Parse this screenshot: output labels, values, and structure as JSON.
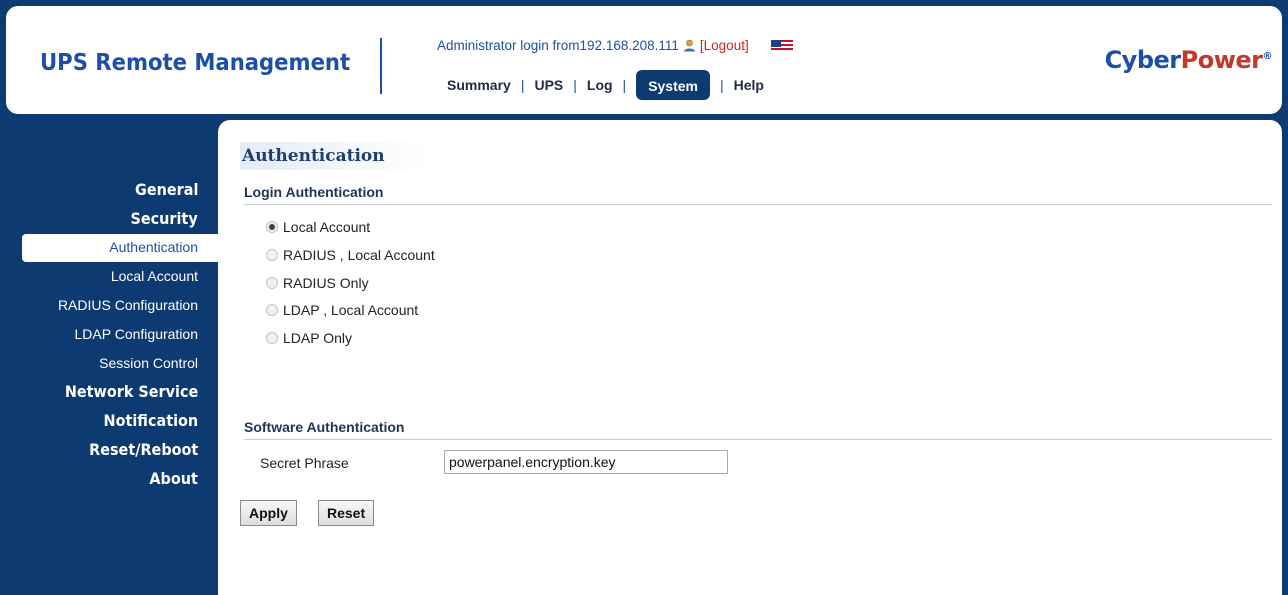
{
  "header": {
    "brand": "UPS Remote Management",
    "login_text": "Administrator login from192.168.208.111",
    "logout_label": "[Logout]",
    "vendor_logo": {
      "part1": "Cyber",
      "part2": "Power",
      "mark": "®"
    }
  },
  "nav": {
    "items": [
      "Summary",
      "UPS",
      "Log",
      "System",
      "Help"
    ],
    "active": "System"
  },
  "sidebar": {
    "items": [
      {
        "label": "General",
        "major": true
      },
      {
        "label": "Security",
        "major": true
      },
      {
        "label": "Authentication",
        "active": true
      },
      {
        "label": "Local Account"
      },
      {
        "label": "RADIUS Configuration"
      },
      {
        "label": "LDAP Configuration"
      },
      {
        "label": "Session Control"
      },
      {
        "label": "Network Service",
        "major": true
      },
      {
        "label": "Notification",
        "major": true
      },
      {
        "label": "Reset/Reboot",
        "major": true
      },
      {
        "label": "About",
        "major": true
      }
    ]
  },
  "main": {
    "page_title": "Authentication",
    "login_auth": {
      "heading": "Login Authentication",
      "options": [
        {
          "label": "Local Account",
          "checked": true
        },
        {
          "label": "RADIUS , Local Account",
          "checked": false
        },
        {
          "label": "RADIUS Only",
          "checked": false
        },
        {
          "label": "LDAP , Local Account",
          "checked": false
        },
        {
          "label": "LDAP Only",
          "checked": false
        }
      ]
    },
    "software_auth": {
      "heading": "Software Authentication",
      "secret_label": "Secret Phrase",
      "secret_value": "powerpanel.encryption.key"
    },
    "buttons": {
      "apply": "Apply",
      "reset": "Reset"
    }
  },
  "colors": {
    "navy": "#0d3a70",
    "brand_blue": "#1e4fa8",
    "logout_red": "#d22020"
  }
}
